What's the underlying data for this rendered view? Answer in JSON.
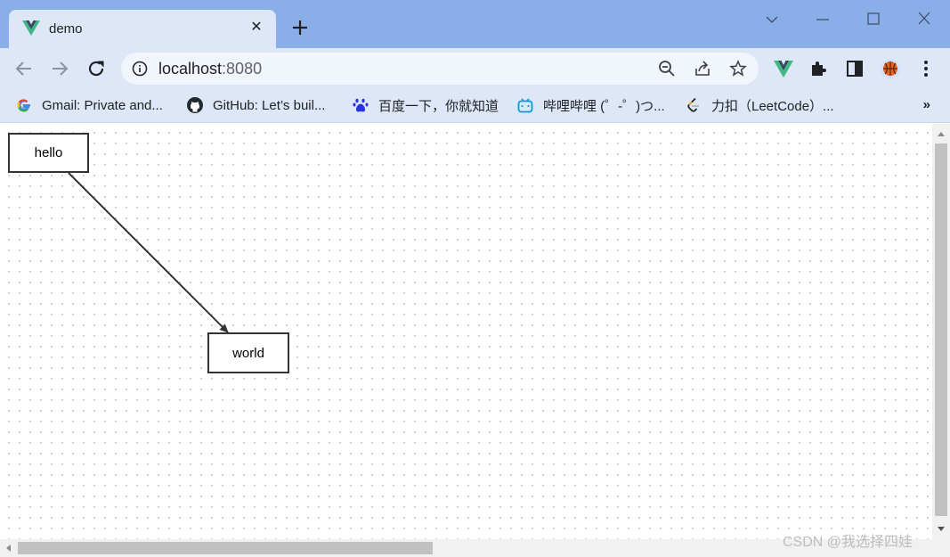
{
  "window": {
    "tab": {
      "title": "demo",
      "icon": "vue-logo-icon"
    },
    "controls": {
      "dropdown": "chevron-down-icon",
      "minimize": "minimize-icon",
      "maximize": "maximize-icon",
      "close": "close-icon"
    }
  },
  "toolbar": {
    "address": {
      "host": "localhost",
      "port": ":8080"
    },
    "actions": [
      "zoom-icon",
      "share-icon",
      "bookmark-star-icon"
    ],
    "extensions": [
      "vue-devtools-icon",
      "puzzle-icon",
      "side-panel-icon",
      "profile-avatar-icon",
      "more-menu-icon"
    ]
  },
  "bookmarks": {
    "items": [
      {
        "label": "Gmail: Private and...",
        "icon": "google-icon"
      },
      {
        "label": "GitHub: Let’s buil...",
        "icon": "github-icon"
      },
      {
        "label": "百度一下，你就知道",
        "icon": "baidu-icon"
      },
      {
        "label": "哔哩哔哩 (゜-゜)つ...",
        "icon": "bilibili-icon"
      },
      {
        "label": "力扣（LeetCode）...",
        "icon": "leetcode-icon"
      }
    ],
    "more": "»"
  },
  "diagram": {
    "nodes": [
      {
        "id": "n1",
        "label": "hello"
      },
      {
        "id": "n2",
        "label": "world"
      }
    ],
    "edges": [
      {
        "from": "n1",
        "to": "n2"
      }
    ]
  },
  "watermark": "CSDN @我选择四娃",
  "colors": {
    "titlebar": "#8aafe8",
    "toolbar": "#dde7f7",
    "node_border": "#333333"
  }
}
